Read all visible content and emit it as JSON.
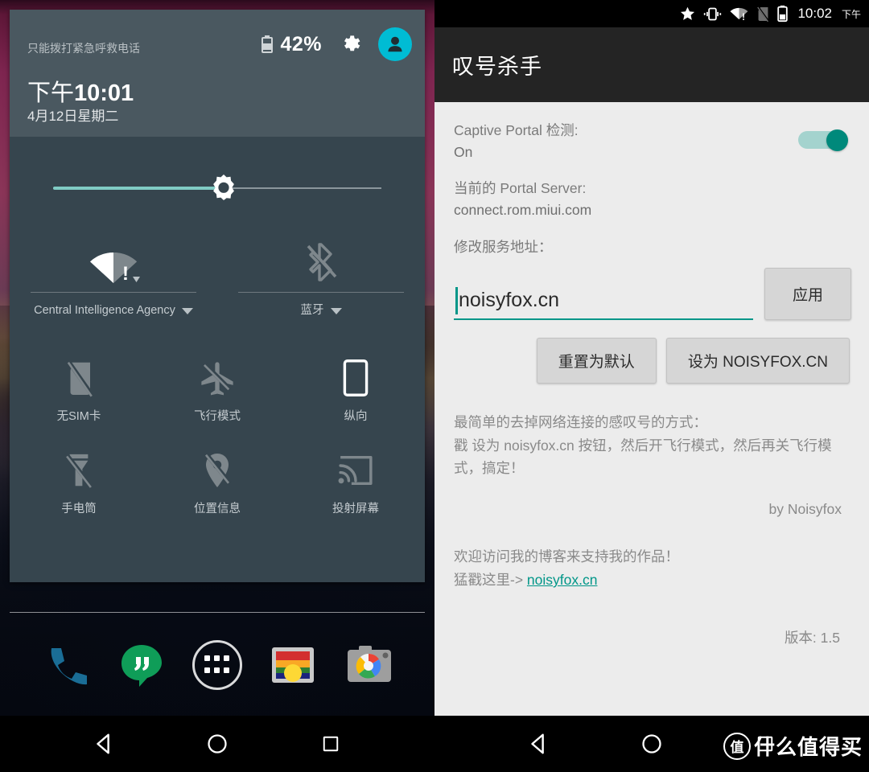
{
  "left_phone": {
    "shade": {
      "emergency_text": "只能拨打紧急呼救电话",
      "battery_percent": "42%",
      "clock_ampm": "下午",
      "clock_time": "10:01",
      "date": "4月12日星期二",
      "brightness_percent": 52,
      "wide_tiles": [
        {
          "label": "Central Intelligence Agency",
          "icon": "wifi-warning-icon",
          "has_caret": true
        },
        {
          "label": "蓝牙",
          "icon": "bluetooth-off-icon",
          "has_caret": true
        }
      ],
      "tiles": [
        {
          "label": "无SIM卡",
          "icon": "no-sim-icon"
        },
        {
          "label": "飞行模式",
          "icon": "airplane-icon"
        },
        {
          "label": "纵向",
          "icon": "portrait-rotation-icon"
        },
        {
          "label": "手电筒",
          "icon": "flashlight-off-icon"
        },
        {
          "label": "位置信息",
          "icon": "location-off-icon"
        },
        {
          "label": "投射屏幕",
          "icon": "cast-screen-icon"
        }
      ]
    },
    "dock": [
      {
        "name": "phone-app-icon"
      },
      {
        "name": "hangouts-app-icon"
      },
      {
        "name": "app-drawer-icon"
      },
      {
        "name": "photos-app-icon"
      },
      {
        "name": "camera-app-icon"
      }
    ]
  },
  "right_phone": {
    "statusbar": {
      "icons": [
        "star-icon",
        "vibrate-icon",
        "wifi-warning-icon",
        "no-sim-icon",
        "battery-icon"
      ],
      "time": "10:02",
      "ampm": "下午"
    },
    "app": {
      "title": "叹号杀手",
      "captive_label": "Captive Portal 检测:",
      "captive_value": "On",
      "captive_toggle_on": true,
      "server_label": "当前的 Portal Server:",
      "server_value": "connect.rom.miui.com",
      "edit_label": "修改服务地址：",
      "input_value": "noisyfox.cn",
      "input_placeholder": "",
      "apply_button": "应用",
      "reset_button": "重置为默认",
      "set_noisyfox_button": "设为 NOISYFOX.CN",
      "description": "最简单的去掉网络连接的感叹号的方式：\n戳 设为 noisyfox.cn 按钮，然后开飞行模式，然后再关飞行模式，搞定！",
      "byline": "by Noisyfox",
      "blog_line1": "欢迎访问我的博客来支持我的作品！",
      "blog_prefix": "猛戳这里-> ",
      "blog_link": "noisyfox.cn",
      "version": "版本: 1.5"
    }
  },
  "navbar": {
    "buttons": [
      "back-icon",
      "home-icon",
      "recents-icon"
    ],
    "watermark_logo": "值",
    "watermark_text": "什么值得买"
  },
  "colors": {
    "accent_teal": "#009688",
    "toggle_on": "#00897B",
    "shade_bg": "#36454E",
    "shade_header": "#4A5860",
    "appbar": "#242424",
    "content_bg": "#ECECEC",
    "avatar_cyan": "#00BCD4",
    "brightness_fill": "#80CBC4"
  }
}
